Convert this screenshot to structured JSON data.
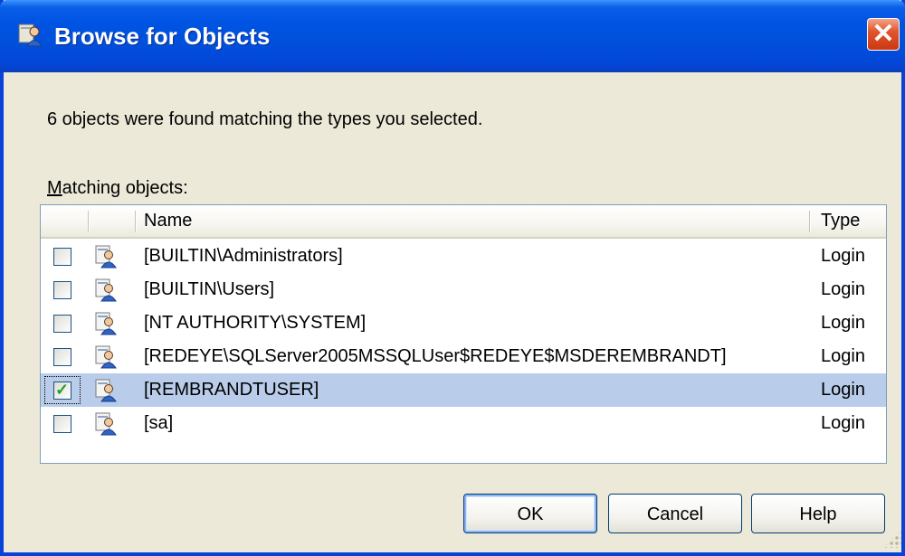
{
  "window": {
    "title": "Browse for Objects",
    "close_glyph": "✕"
  },
  "message": "6 objects were found matching the types you selected.",
  "list": {
    "label_accel": "M",
    "label_rest": "atching objects:",
    "columns": [
      "",
      "",
      "Name",
      "Type"
    ],
    "rows": [
      {
        "name": "[BUILTIN\\Administrators]",
        "type": "Login",
        "checked": false
      },
      {
        "name": "[BUILTIN\\Users]",
        "type": "Login",
        "checked": false
      },
      {
        "name": "[NT AUTHORITY\\SYSTEM]",
        "type": "Login",
        "checked": false
      },
      {
        "name": "[REDEYE\\SQLServer2005MSSQLUser$REDEYE$MSDEREMBRANDT]",
        "type": "Login",
        "checked": false
      },
      {
        "name": "[REMBRANDTUSER]",
        "type": "Login",
        "checked": true
      },
      {
        "name": "[sa]",
        "type": "Login",
        "checked": false
      }
    ],
    "row_icon": "login-user-icon",
    "checkmark": "✓"
  },
  "buttons": {
    "ok": "OK",
    "cancel": "Cancel",
    "help": "Help"
  },
  "colors": {
    "title_bar": "#0054e3",
    "selected_row": "#b9cce9",
    "close_button": "#e2562c",
    "dialog_bg": "#ece9d8"
  }
}
